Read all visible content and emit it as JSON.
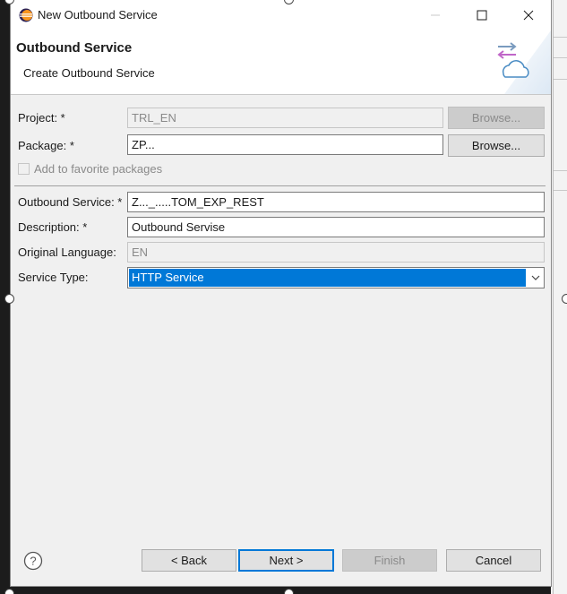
{
  "window": {
    "title": "New Outbound Service"
  },
  "banner": {
    "title": "Outbound Service",
    "description": "Create Outbound Service"
  },
  "form": {
    "project": {
      "label": "Project: *",
      "value": "TRL_EN",
      "browse_label": "Browse..."
    },
    "package": {
      "label": "Package: *",
      "value": "ZP...",
      "browse_label": "Browse..."
    },
    "favorite": {
      "label": "Add to favorite packages",
      "checked": false
    },
    "outbound_service": {
      "label": "Outbound Service: *",
      "value": "Z..._.....TOM_EXP_REST"
    },
    "description": {
      "label": "Description: *",
      "value": "Outbound Servise"
    },
    "original_language": {
      "label": "Original Language:",
      "value": "EN"
    },
    "service_type": {
      "label": "Service Type:",
      "value": "HTTP Service"
    }
  },
  "footer": {
    "back_label": "< Back",
    "next_label": "Next >",
    "finish_label": "Finish",
    "cancel_label": "Cancel"
  },
  "icons": {
    "app": "eclipse-icon",
    "banner": "cloud-arrows-icon",
    "help": "help-icon"
  },
  "colors": {
    "selection": "#0078d7",
    "dialog_bg": "#f0f0f0",
    "banner_bg": "#ffffff"
  }
}
